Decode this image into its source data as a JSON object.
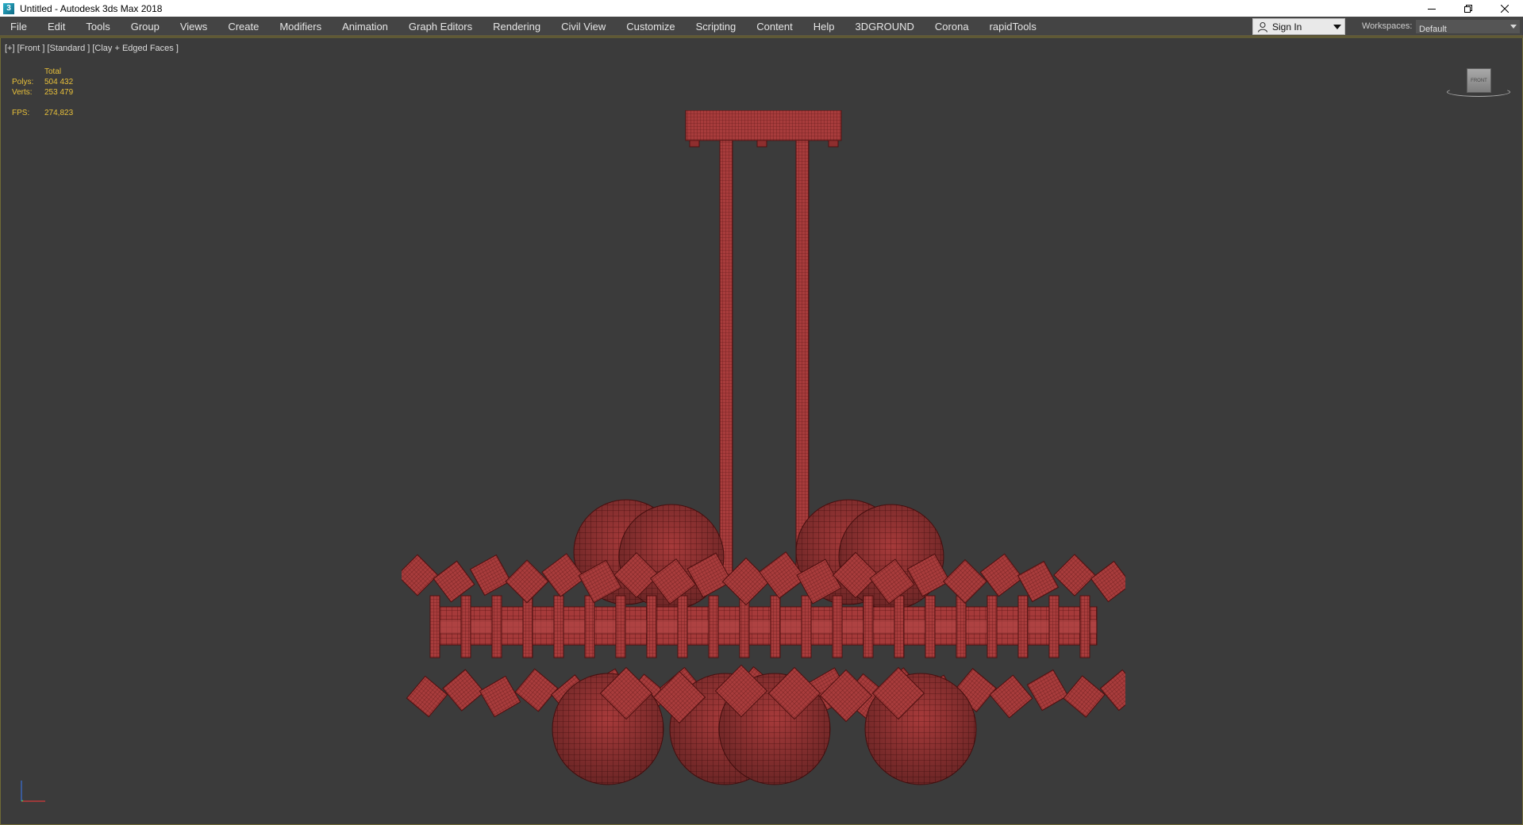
{
  "window": {
    "title": "Untitled - Autodesk 3ds Max 2018",
    "app_icon_glyph": "3"
  },
  "menu": {
    "items": [
      "File",
      "Edit",
      "Tools",
      "Group",
      "Views",
      "Create",
      "Modifiers",
      "Animation",
      "Graph Editors",
      "Rendering",
      "Civil View",
      "Customize",
      "Scripting",
      "Content",
      "Help",
      "3DGROUND",
      "Corona",
      "rapidTools"
    ],
    "sign_in": "Sign In",
    "workspaces_label": "Workspaces:",
    "workspace_value": "Default"
  },
  "viewport": {
    "label": "[+] [Front ] [Standard ] [Clay + Edged Faces ]",
    "stats": {
      "header": "Total",
      "polys_label": "Polys:",
      "polys_value": "504 432",
      "verts_label": "Verts:",
      "verts_value": "253 479",
      "fps_label": "FPS:",
      "fps_value": "274,823"
    },
    "viewcube_face": "FRONT"
  },
  "colors": {
    "accent": "#e8c03a",
    "model": "#a83a3a",
    "model_dark": "#5e1414",
    "viewport_bg": "#3b3b3b"
  },
  "icons": [
    "app-logo-icon",
    "minimize-icon",
    "restore-icon",
    "close-icon",
    "user-icon",
    "chevron-down-icon",
    "viewcube-icon",
    "axis-tripod-icon"
  ]
}
